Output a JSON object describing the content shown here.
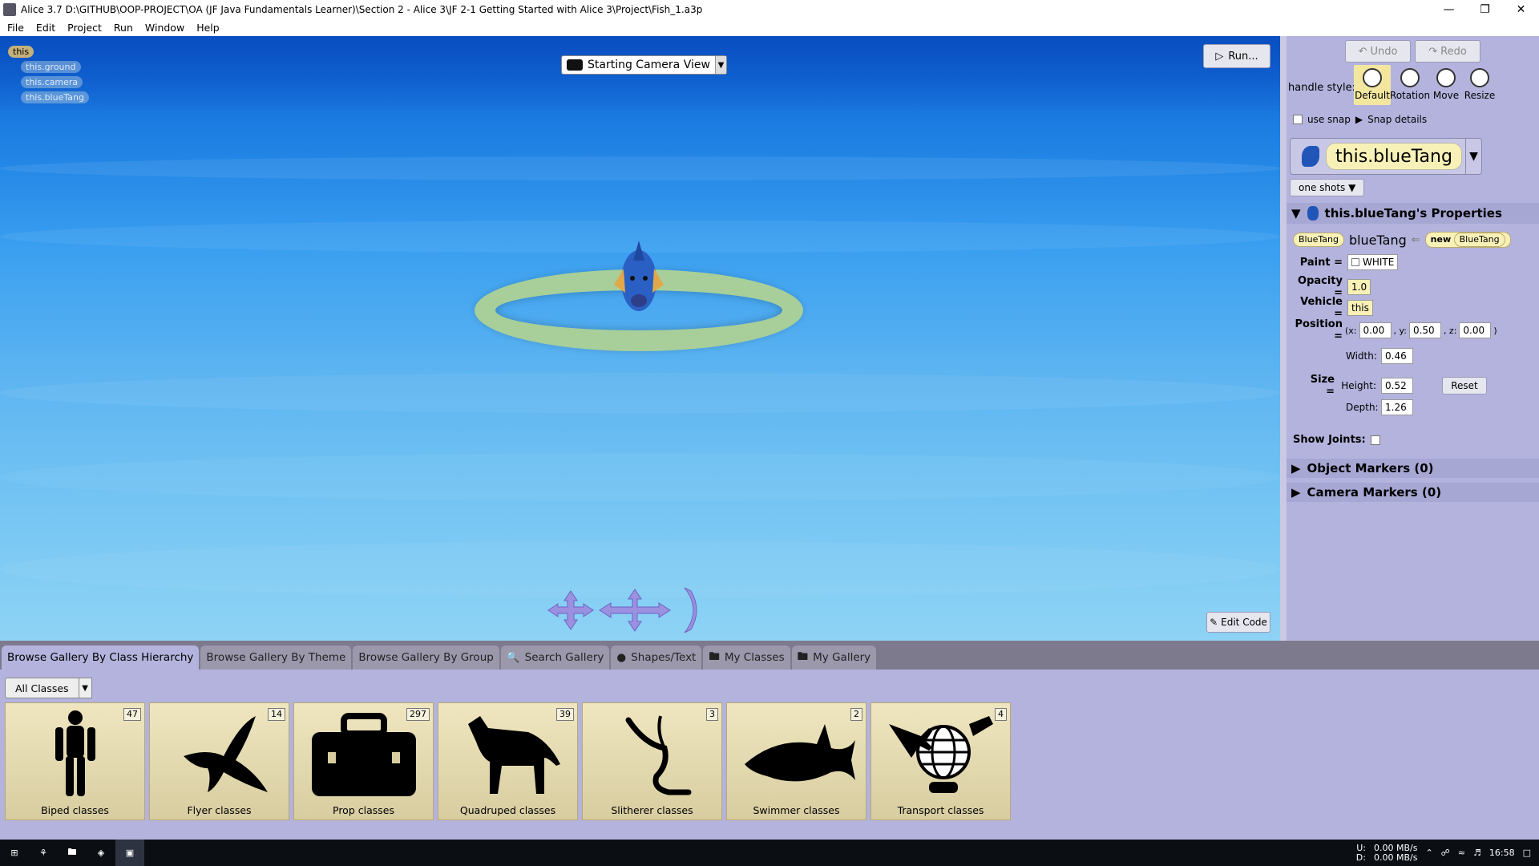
{
  "window": {
    "title": "Alice 3.7 D:\\GITHUB\\OOP-PROJECT\\OA (JF Java Fundamentals Learner)\\Section 2 - Alice 3\\JF 2-1 Getting Started with Alice 3\\Project\\Fish_1.a3p"
  },
  "menu": [
    "File",
    "Edit",
    "Project",
    "Run",
    "Window",
    "Help"
  ],
  "scene_tree": {
    "root": "this",
    "children": [
      "this.ground",
      "this.camera",
      "this.blueTang"
    ]
  },
  "scene": {
    "camera_view": "Starting Camera View",
    "run_label": "Run...",
    "edit_code_label": "Edit Code"
  },
  "panel": {
    "undo": "Undo",
    "redo": "Redo",
    "handle_style_label": "handle style:",
    "handle_styles": [
      "Default",
      "Rotation",
      "Move",
      "Resize"
    ],
    "use_snap": "use snap",
    "snap_details": "Snap details",
    "selected_object": "this.blueTang",
    "one_shots": "one shots",
    "properties_title": "this.blueTang's Properties",
    "type_tile": "BlueTang",
    "instance_name": "blueTang",
    "new_label": "new",
    "new_type": "BlueTang",
    "paint_label": "Paint =",
    "paint_value": "WHITE",
    "opacity_label": "Opacity =",
    "opacity_value": "1.0",
    "vehicle_label": "Vehicle =",
    "vehicle_value": "this",
    "position_label": "Position =",
    "pos_x_label": "(x:",
    "pos_x": "0.00",
    "pos_y_label": ", y:",
    "pos_y": "0.50",
    "pos_z_label": ", z:",
    "pos_z": "0.00",
    "pos_close": ")",
    "size_label": "Size =",
    "width_label": "Width:",
    "width": "0.46",
    "height_label": "Height:",
    "height": "0.52",
    "depth_label": "Depth:",
    "depth": "1.26",
    "reset": "Reset",
    "show_joints": "Show Joints:",
    "object_markers": "Object Markers (0)",
    "camera_markers": "Camera Markers (0)"
  },
  "gallery_tabs": [
    "Browse Gallery By Class Hierarchy",
    "Browse Gallery By Theme",
    "Browse Gallery By Group",
    "Search Gallery",
    "Shapes/Text",
    "My Classes",
    "My Gallery"
  ],
  "gallery": {
    "filter": "All Classes",
    "cards": [
      {
        "label": "Biped classes",
        "count": "47"
      },
      {
        "label": "Flyer classes",
        "count": "14"
      },
      {
        "label": "Prop classes",
        "count": "297"
      },
      {
        "label": "Quadruped classes",
        "count": "39"
      },
      {
        "label": "Slitherer classes",
        "count": "3"
      },
      {
        "label": "Swimmer classes",
        "count": "2"
      },
      {
        "label": "Transport classes",
        "count": "4"
      }
    ]
  },
  "taskbar": {
    "net_up_label": "U:",
    "net_down_label": "D:",
    "net_up": "0.00 MB/s",
    "net_down": "0.00 MB/s",
    "time": "16:58"
  }
}
